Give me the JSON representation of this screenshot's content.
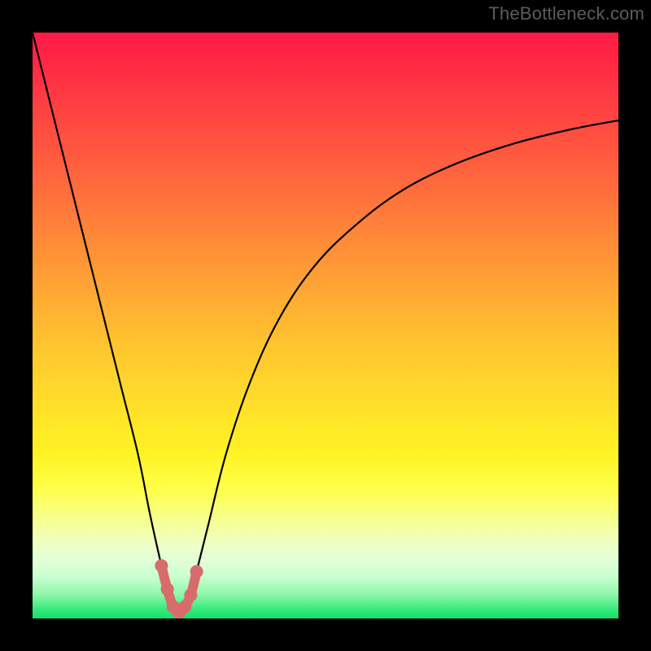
{
  "watermark": "TheBottleneck.com",
  "chart_data": {
    "type": "line",
    "title": "",
    "xlabel": "",
    "ylabel": "",
    "xlim": [
      0,
      100
    ],
    "ylim": [
      0,
      100
    ],
    "grid": false,
    "legend": false,
    "series": [
      {
        "name": "curve",
        "x": [
          0,
          3,
          6,
          9,
          12,
          15,
          18,
          20,
          22,
          23,
          24,
          25,
          26,
          27,
          28,
          30,
          33,
          37,
          42,
          48,
          55,
          63,
          72,
          82,
          92,
          100
        ],
        "y": [
          100,
          88,
          76,
          64,
          52,
          40,
          28,
          18,
          9,
          5,
          2,
          1,
          2,
          4,
          8,
          16,
          28,
          40,
          51,
          60,
          67,
          73,
          77.5,
          81,
          83.5,
          85
        ]
      }
    ],
    "highlight": {
      "name": "bottleneck-region",
      "x": [
        22,
        23,
        24,
        25,
        26,
        27,
        28
      ],
      "y": [
        9,
        5,
        2,
        1,
        2,
        4,
        8
      ],
      "color": "#d86b6b"
    },
    "background_gradient": {
      "direction": "vertical",
      "stops": [
        {
          "pos": 0.0,
          "color": "#ff1a46"
        },
        {
          "pos": 0.5,
          "color": "#ffad33"
        },
        {
          "pos": 0.75,
          "color": "#feff4b"
        },
        {
          "pos": 0.93,
          "color": "#c7ffd0"
        },
        {
          "pos": 1.0,
          "color": "#14e06a"
        }
      ]
    }
  }
}
